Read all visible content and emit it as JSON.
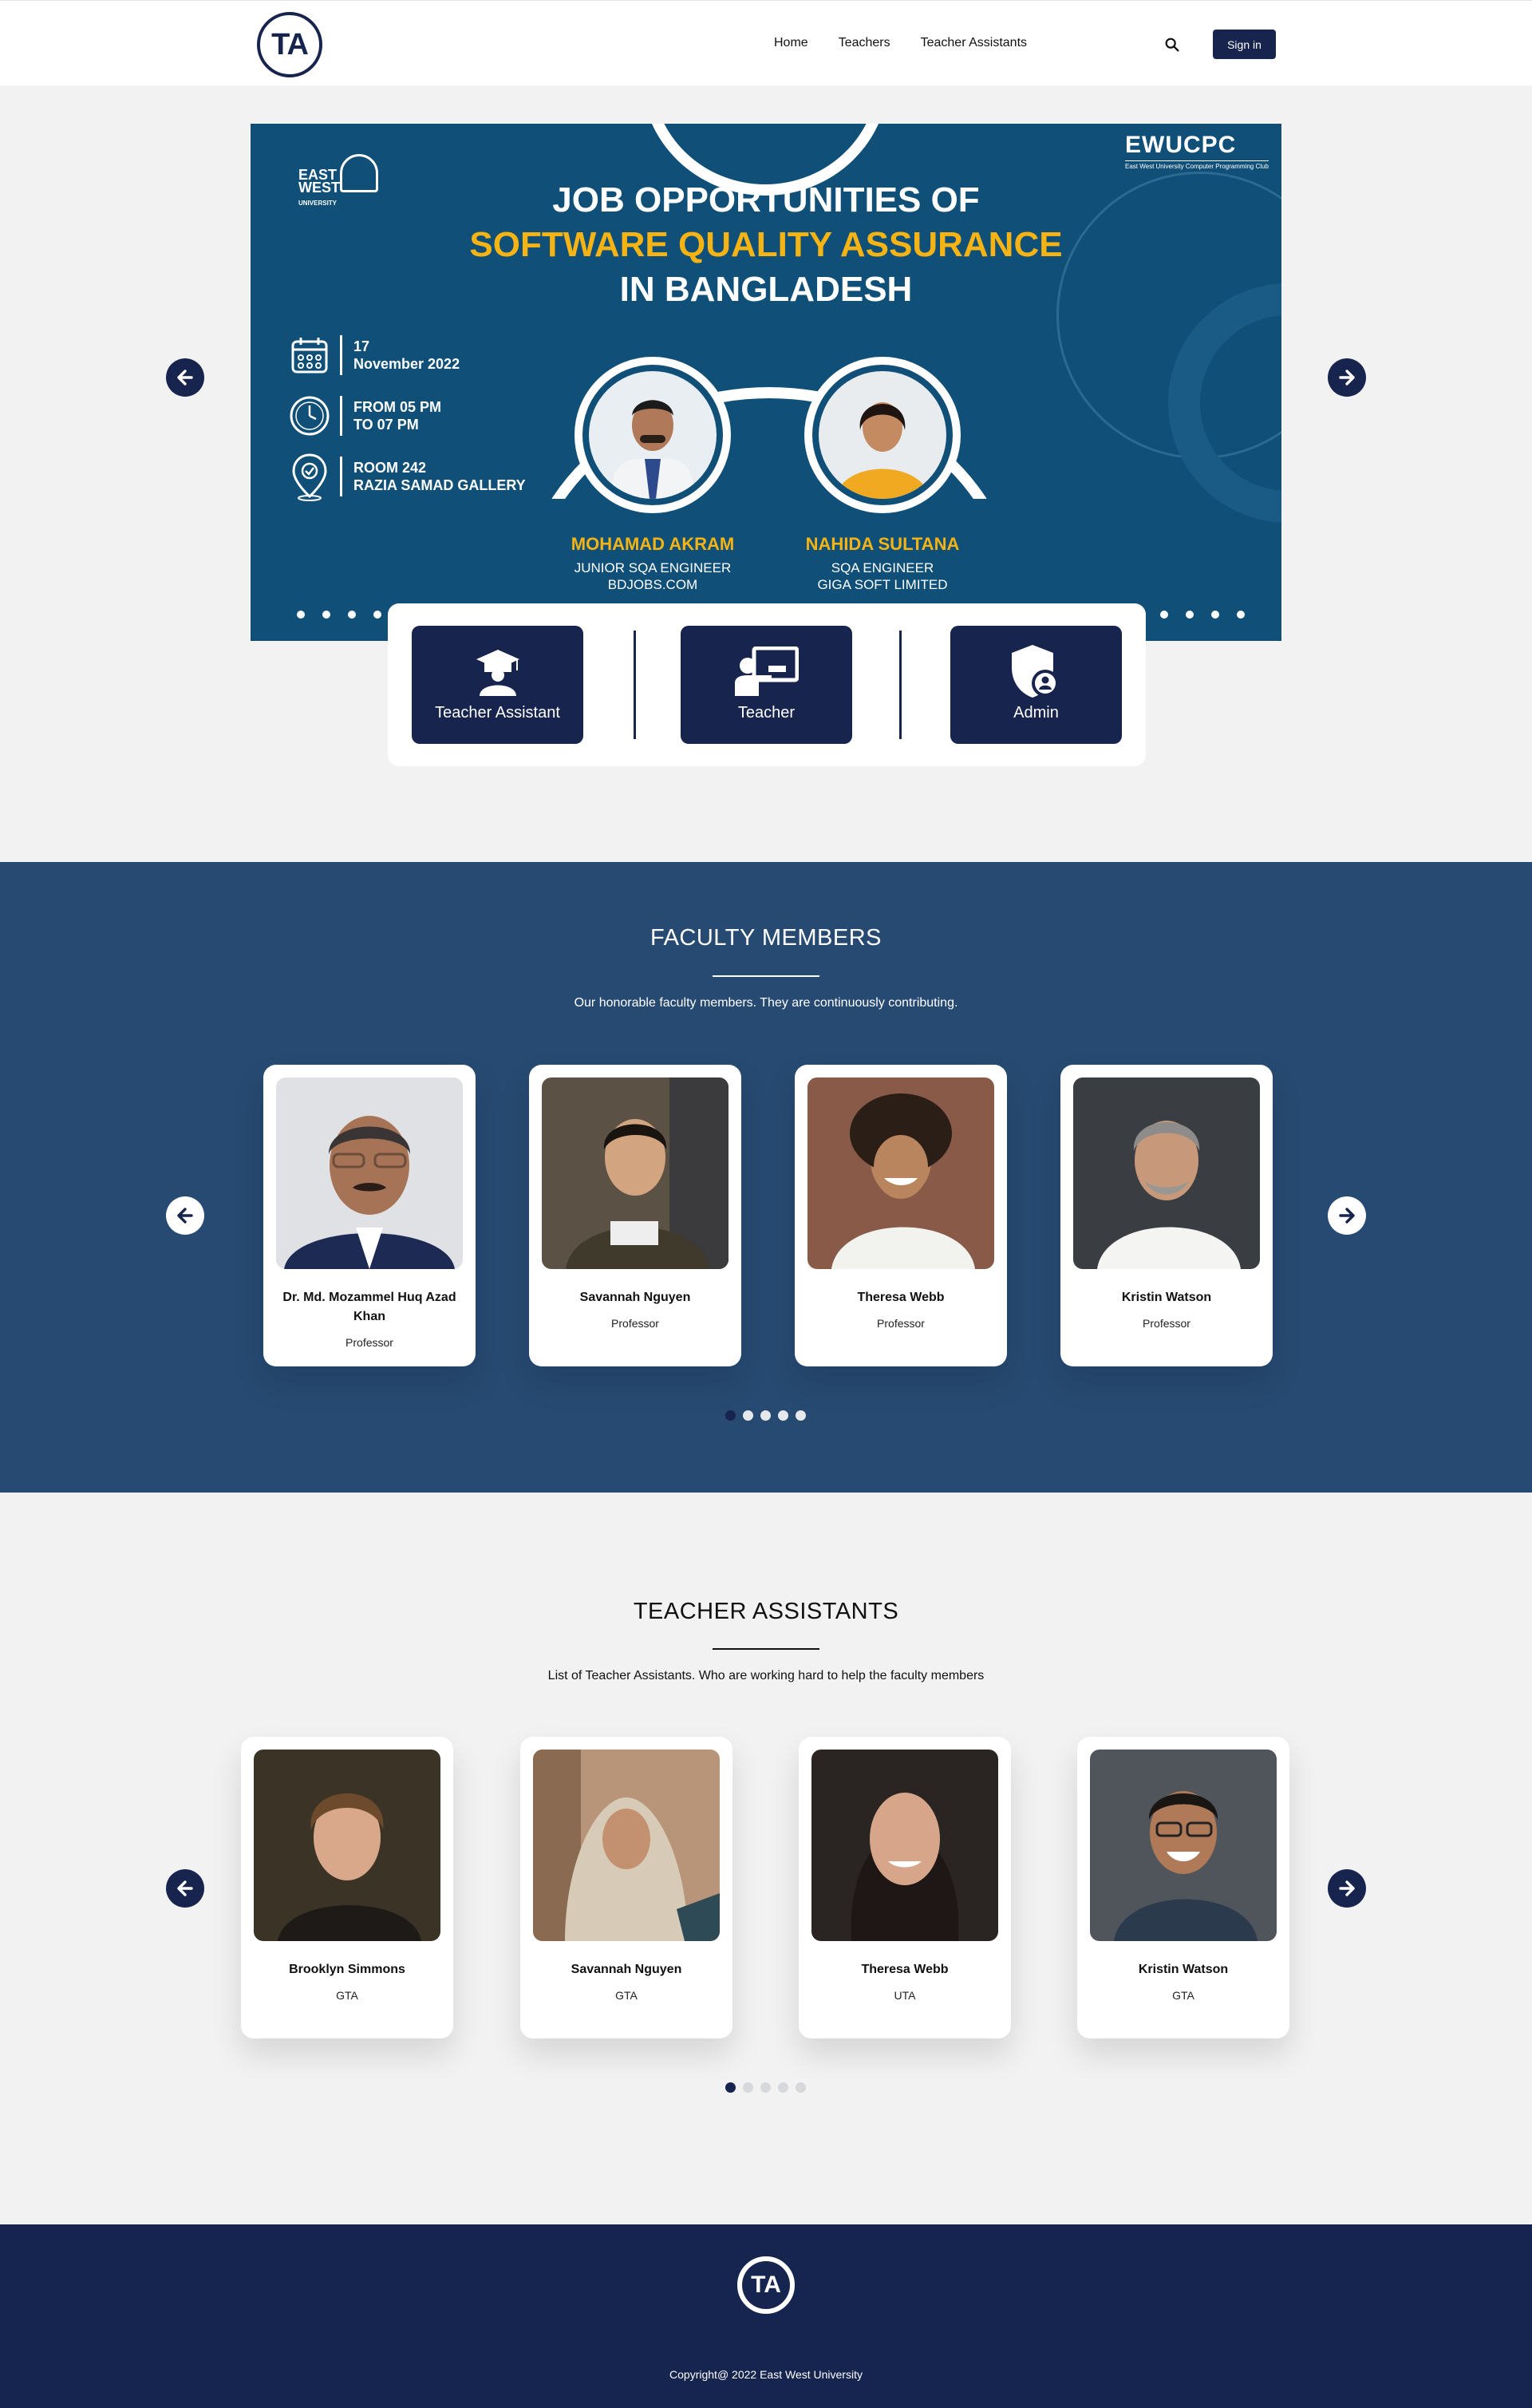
{
  "header": {
    "logo_text": "TA",
    "nav": [
      "Home",
      "Teachers",
      "Teacher Assistants"
    ],
    "search_icon": "search-icon",
    "signin_label": "Sign in"
  },
  "hero": {
    "university_logo": "EAST WEST UNIVERSITY",
    "club_logo": "EWUCPC",
    "club_caption": "East West University Computer Programming Club",
    "title_line1": "JOB OPPORTUNITIES OF",
    "title_line2": "SOFTWARE QUALITY ASSURANCE",
    "title_line3": "IN BANGLADESH",
    "date_line1": "17",
    "date_line2": "November 2022",
    "time_line1": "FROM 05 PM",
    "time_line2": "TO 07 PM",
    "venue_line1": "ROOM 242",
    "venue_line2": "RAZIA SAMAD GALLERY",
    "speakers": [
      {
        "name": "MOHAMAD AKRAM",
        "role1": "JUNIOR SQA ENGINEER",
        "role2": "BDJOBS.COM"
      },
      {
        "name": "NAHIDA SULTANA",
        "role1": "SQA ENGINEER",
        "role2": "GIGA SOFT LIMITED"
      }
    ],
    "accent": "#f5b414"
  },
  "roles": [
    {
      "label": "Teacher Assistant",
      "icon": "graduate-icon"
    },
    {
      "label": "Teacher",
      "icon": "teacher-board-icon"
    },
    {
      "label": "Admin",
      "icon": "admin-shield-icon"
    }
  ],
  "faculty": {
    "title": "FACULTY MEMBERS",
    "subtitle": "Our honorable faculty members. They are continuously contributing.",
    "members": [
      {
        "name": "Dr. Md. Mozammel Huq Azad Khan",
        "role": "Professor"
      },
      {
        "name": "Savannah Nguyen",
        "role": "Professor"
      },
      {
        "name": "Theresa Webb",
        "role": "Professor"
      },
      {
        "name": "Kristin Watson",
        "role": "Professor"
      }
    ],
    "page_count": 5,
    "active_page": 1
  },
  "assistants": {
    "title": "TEACHER ASSISTANTS",
    "subtitle": "List of Teacher Assistants. Who are working hard to help the faculty members",
    "members": [
      {
        "name": "Brooklyn Simmons",
        "role": "GTA"
      },
      {
        "name": "Savannah Nguyen",
        "role": "GTA"
      },
      {
        "name": "Theresa Webb",
        "role": "UTA"
      },
      {
        "name": "Kristin Watson",
        "role": "GTA"
      }
    ],
    "page_count": 5,
    "active_page": 1
  },
  "footer": {
    "logo_text": "TA",
    "copyright": "Copyright@ 2022 East West University"
  },
  "colors": {
    "primary": "#17244d",
    "faculty_bg": "#274a72",
    "footer_bg": "#162450",
    "hero_bg": "#0f4f78"
  }
}
